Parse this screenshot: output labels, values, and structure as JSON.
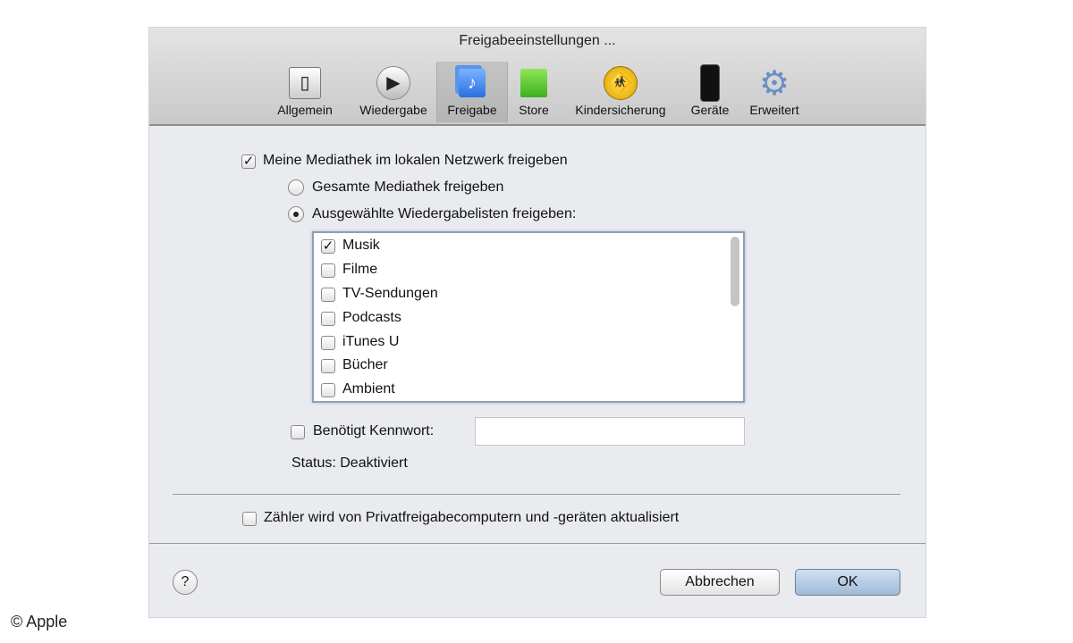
{
  "window": {
    "title": "Freigabeeinstellungen ..."
  },
  "toolbar": [
    {
      "label": "Allgemein",
      "icon": "switch-icon"
    },
    {
      "label": "Wiedergabe",
      "icon": "play-icon"
    },
    {
      "label": "Freigabe",
      "icon": "shared-music-icon",
      "selected": true
    },
    {
      "label": "Store",
      "icon": "shopping-bag-icon"
    },
    {
      "label": "Kindersicherung",
      "icon": "parental-control-icon"
    },
    {
      "label": "Geräte",
      "icon": "iphone-icon"
    },
    {
      "label": "Erweitert",
      "icon": "gear-icon"
    }
  ],
  "share": {
    "label": "Meine Mediathek im lokalen Netzwerk freigeben",
    "checked": true
  },
  "radios": [
    {
      "label": "Gesamte Mediathek freigeben",
      "selected": false
    },
    {
      "label": "Ausgewählte Wiedergabelisten freigeben:",
      "selected": true
    }
  ],
  "playlists": [
    {
      "label": "Musik",
      "checked": true
    },
    {
      "label": "Filme",
      "checked": false
    },
    {
      "label": "TV-Sendungen",
      "checked": false
    },
    {
      "label": "Podcasts",
      "checked": false
    },
    {
      "label": "iTunes U",
      "checked": false
    },
    {
      "label": "Bücher",
      "checked": false
    },
    {
      "label": "Ambient",
      "checked": false
    }
  ],
  "password": {
    "label": "Benötigt Kennwort:",
    "checked": false,
    "value": ""
  },
  "status": "Status: Deaktiviert",
  "counter": {
    "label": "Zähler wird von Privatfreigabecomputern und -geräten aktualisiert",
    "checked": false
  },
  "buttons": {
    "help": "?",
    "cancel": "Abbrechen",
    "ok": "OK"
  },
  "copyright": "© Apple"
}
